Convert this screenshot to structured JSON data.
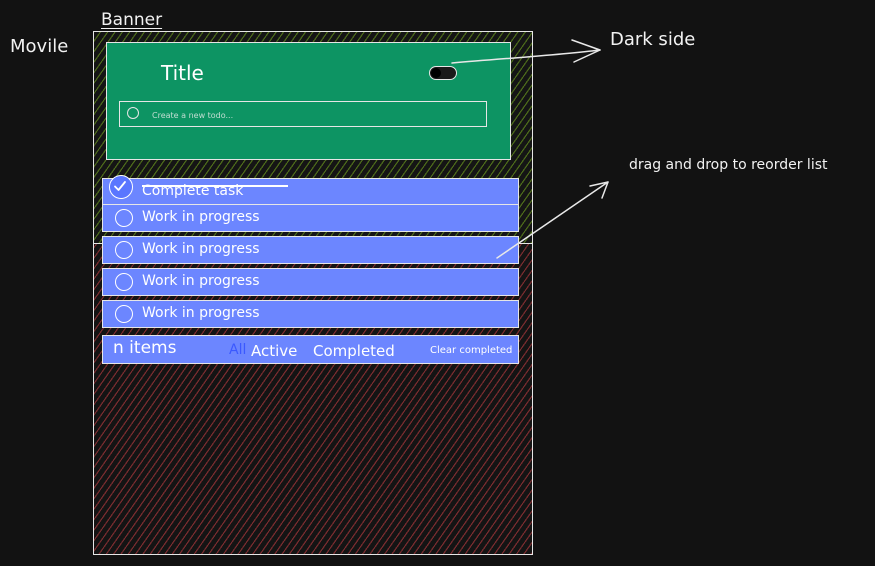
{
  "annotations": {
    "movile": "Movile",
    "banner": "Banner",
    "dark_side": "Dark side",
    "drag_drop": "drag and drop to reorder list"
  },
  "header": {
    "title": "Title",
    "new_todo_placeholder": "Create a new todo..."
  },
  "todos": [
    {
      "label": "Complete task",
      "completed": true
    },
    {
      "label": "Work in progress",
      "completed": false
    },
    {
      "label": "Work in progress",
      "completed": false
    },
    {
      "label": "Work in progress",
      "completed": false
    },
    {
      "label": "Work in progress",
      "completed": false
    }
  ],
  "footer": {
    "items_count": "n items",
    "filter_all": "All",
    "filter_active": "Active",
    "filter_completed": "Completed",
    "clear_completed": "Clear completed"
  },
  "colors": {
    "background": "#121212",
    "header_card": "#0d9463",
    "todo_row": "#6c86ff",
    "banner_hatch": "#4d6b1b",
    "body_hatch": "#7a2c2f"
  }
}
